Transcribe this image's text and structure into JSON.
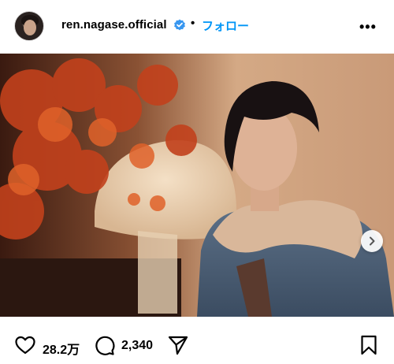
{
  "post": {
    "username": "ren.nagase.official",
    "separator": "•",
    "follow_label": "フォロー",
    "more_label": "•••"
  },
  "carousel": {
    "slide_count": 4,
    "active_index": 0
  },
  "actions": {
    "likes": "28.2万",
    "comments": "2,340"
  },
  "colors": {
    "follow_blue": "#0095f6",
    "verified_blue": "#3897f0"
  },
  "icons": [
    "verified-badge-icon",
    "more-options-icon",
    "chevron-right-icon",
    "heart-icon",
    "comment-icon",
    "share-icon",
    "bookmark-icon"
  ]
}
